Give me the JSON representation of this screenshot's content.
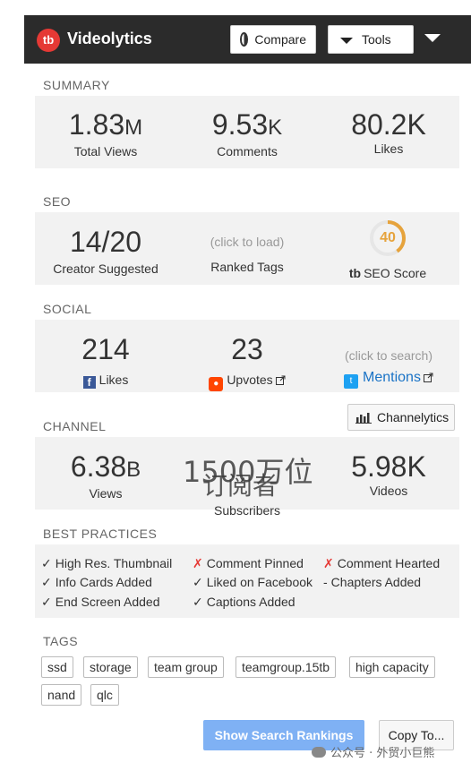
{
  "header": {
    "app_name": "Videolytics",
    "logo_text": "tb",
    "compare_label": "Compare",
    "tools_label": "Tools"
  },
  "summary": {
    "label": "SUMMARY",
    "views_num": "1.83",
    "views_suffix": "M",
    "views_label": "Total Views",
    "comments_num": "9.53",
    "comments_suffix": "K",
    "comments_label": "Comments",
    "likes_num": "80.2K",
    "likes_label": "Likes"
  },
  "seo": {
    "label": "SEO",
    "creator_value": "14/20",
    "creator_label": "Creator Suggested",
    "ranked_hint": "(click to load)",
    "ranked_label": "Ranked Tags",
    "score": "40",
    "score_fraction": 0.4,
    "score_label": "SEO Score"
  },
  "social": {
    "label": "SOCIAL",
    "fb_value": "214",
    "fb_label": "Likes",
    "reddit_value": "23",
    "reddit_label": "Upvotes",
    "mentions_hint": "(click to search)",
    "mentions_label": "Mentions"
  },
  "channel": {
    "label": "CHANNEL",
    "channelytics_label": "Channelytics",
    "views_num": "6.38",
    "views_suffix": "B",
    "views_label": "Views",
    "subs_value": "1500万位",
    "subs_overlay": "订阅者",
    "subs_label": "Subscribers",
    "videos_value": "5.98K",
    "videos_label": "Videos"
  },
  "best_practices": {
    "label": "BEST PRACTICES",
    "items": [
      {
        "mark": "✓",
        "text": "High Res. Thumbnail",
        "kind": "ok"
      },
      {
        "mark": "✗",
        "text": "Comment Pinned",
        "kind": "x"
      },
      {
        "mark": "✗",
        "text": "Comment Hearted",
        "kind": "x"
      },
      {
        "mark": "✓",
        "text": "Info Cards Added",
        "kind": "ok"
      },
      {
        "mark": "✓",
        "text": "Liked on Facebook",
        "kind": "ok"
      },
      {
        "mark": "-",
        "text": "Chapters Added",
        "kind": "dash"
      },
      {
        "mark": "✓",
        "text": "End Screen Added",
        "kind": "ok"
      },
      {
        "mark": "✓",
        "text": "Captions Added",
        "kind": "ok"
      }
    ]
  },
  "tags": {
    "label": "TAGS",
    "items": [
      "ssd",
      "storage",
      "team group",
      "teamgroup.15tb",
      "high capacity",
      "nand",
      "qlc"
    ]
  },
  "footer": {
    "show_rankings_label": "Show Search Rankings",
    "copy_label": "Copy To...",
    "watermark": "公众号 · 外贸小巨熊"
  },
  "colors": {
    "header_bg": "#2b2b2b",
    "logo_red": "#e53935",
    "seo_score": "#e6a33c",
    "link_blue": "#1a73c6",
    "primary_button": "#7fb1f4"
  }
}
